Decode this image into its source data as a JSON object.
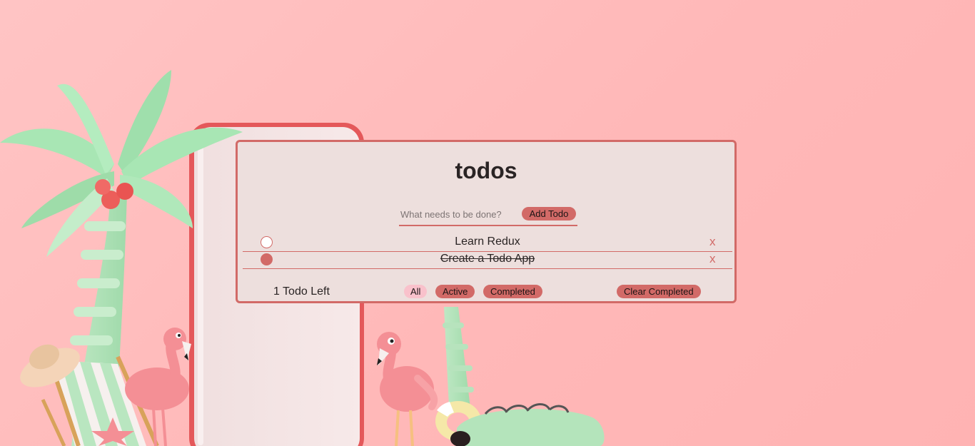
{
  "app": {
    "title": "todos"
  },
  "input": {
    "placeholder": "What needs to be done?",
    "value": "",
    "add_label": "Add Todo"
  },
  "todos": [
    {
      "text": "Learn Redux",
      "completed": false,
      "delete_label": "x"
    },
    {
      "text": "Create a Todo App",
      "completed": true,
      "delete_label": "x"
    }
  ],
  "footer": {
    "count_label": "1 Todo Left",
    "filters": [
      {
        "label": "All",
        "selected": true
      },
      {
        "label": "Active",
        "selected": false
      },
      {
        "label": "Completed",
        "selected": false
      }
    ],
    "clear_label": "Clear Completed"
  },
  "colors": {
    "accent": "#d26a67",
    "card_bg": "#eddfdd",
    "page_bg": "#ffb8b8",
    "selected_filter": "#f9c1cb",
    "palm_leaf": "#a8e6b4",
    "flamingo": "#f48f95"
  }
}
